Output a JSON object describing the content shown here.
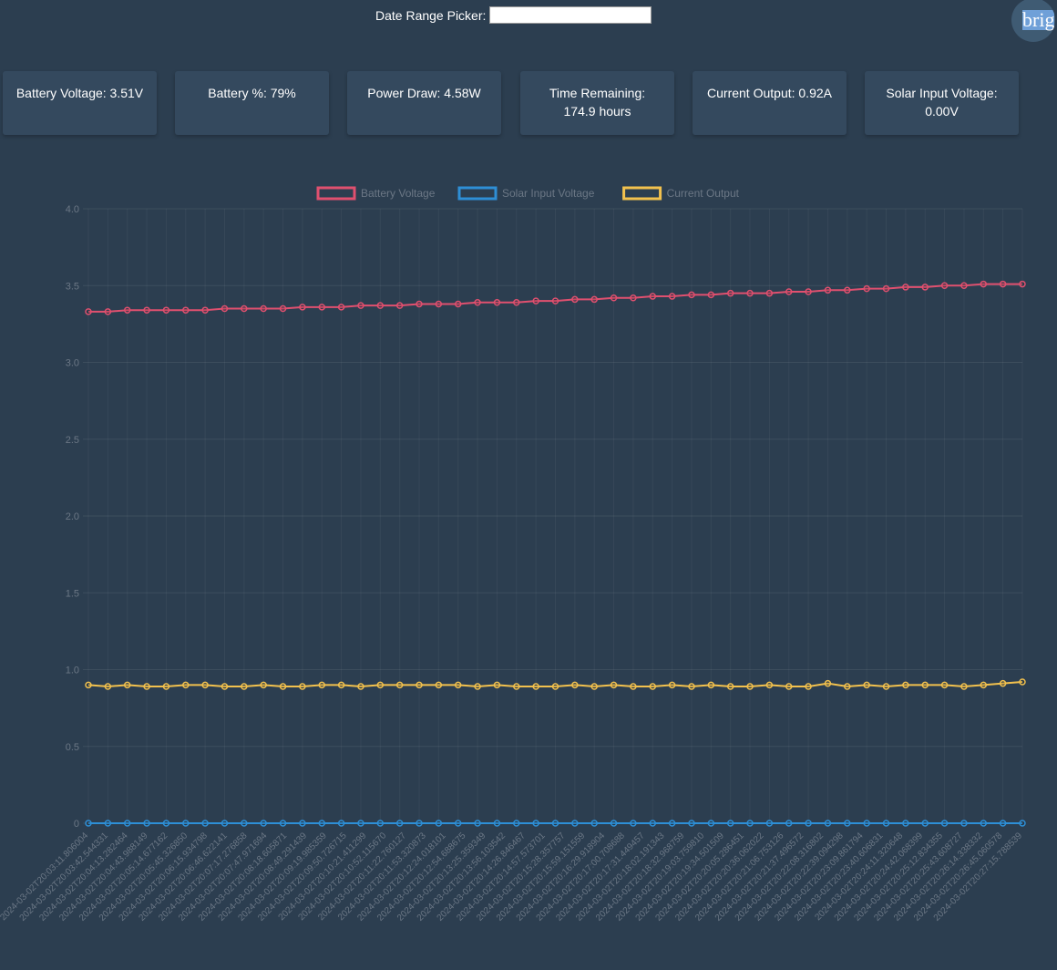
{
  "header": {
    "date_label": "Date Range Picker:",
    "date_value": "",
    "avatar_text": "brig"
  },
  "cards": [
    {
      "label": "Battery Voltage: 3.51V"
    },
    {
      "label": "Battery %: 79%"
    },
    {
      "label": "Power Draw: 4.58W"
    },
    {
      "label": "Time Remaining: 174.9 hours"
    },
    {
      "label": "Current Output: 0.92A"
    },
    {
      "label": "Solar Input Voltage: 0.00V"
    }
  ],
  "colors": {
    "background": "#2c3e50",
    "card": "#34495e",
    "battery": "#e0506f",
    "solar": "#2e8fd6",
    "current": "#f2c14e"
  },
  "chart_data": {
    "type": "line",
    "ylim": [
      0,
      4
    ],
    "yticks": [
      "0",
      "0.5",
      "1.0",
      "1.5",
      "2.0",
      "2.5",
      "3.0",
      "3.5",
      "4.0"
    ],
    "grid": true,
    "legend_position": "top-center",
    "x_tick_labels": [
      "2024-03-02T20:03:11.806004",
      "2024-03-02T20:03:42.544331",
      "2024-03-02T20:04:13.282464",
      "2024-03-02T20:04:43.988149",
      "2024-03-02T20:05:14.677162",
      "2024-03-02T20:05:45.326850",
      "2024-03-02T20:06:15.934798",
      "2024-03-02T20:06:46.622141",
      "2024-03-02T20:07:17.276858",
      "2024-03-02T20:07:47.971694",
      "2024-03-02T20:08:18.605871",
      "2024-03-02T20:08:49.291439",
      "2024-03-02T20:09:19.985359",
      "2024-03-02T20:09:50.726715",
      "2024-03-02T20:10:21.411299",
      "2024-03-02T20:10:52.115670",
      "2024-03-02T20:11:22.760127",
      "2024-03-02T20:11:53.320873",
      "2024-03-02T20:12:24.018101",
      "2024-03-02T20:12:54.688675",
      "2024-03-02T20:13:25.359349",
      "2024-03-02T20:13:56.103542",
      "2024-03-02T20:14:26.846467",
      "2024-03-02T20:14:57.573701",
      "2024-03-02T20:15:28.357757",
      "2024-03-02T20:15:59.151559",
      "2024-03-02T20:16:29.918904",
      "2024-03-02T20:17:00.708688",
      "2024-03-02T20:17:31.449457",
      "2024-03-02T20:18:02.191343",
      "2024-03-02T20:18:32.968759",
      "2024-03-02T20:19:03.759810",
      "2024-03-02T20:19:34.501509",
      "2024-03-02T20:20:05.286451",
      "2024-03-02T20:20:36.062022",
      "2024-03-02T20:21:06.753126",
      "2024-03-02T20:21:37.496572",
      "2024-03-02T20:22:08.316802",
      "2024-03-02T20:22:39.094298",
      "2024-03-02T20:23:09.861794",
      "2024-03-02T20:23:40.606831",
      "2024-03-02T20:24:11.320648",
      "2024-03-02T20:24:42.068399",
      "2024-03-02T20:25:12.834355",
      "2024-03-02T20:25:43.608727",
      "2024-03-02T20:26:14.338332",
      "2024-03-02T20:26:45.060578",
      "2024-03-02T20:27:15.788539"
    ],
    "series": [
      {
        "name": "Battery Voltage",
        "color": "#e0506f",
        "values": [
          3.33,
          3.33,
          3.34,
          3.34,
          3.34,
          3.34,
          3.34,
          3.35,
          3.35,
          3.35,
          3.35,
          3.36,
          3.36,
          3.36,
          3.37,
          3.37,
          3.37,
          3.38,
          3.38,
          3.38,
          3.39,
          3.39,
          3.39,
          3.4,
          3.4,
          3.41,
          3.41,
          3.42,
          3.42,
          3.43,
          3.43,
          3.44,
          3.44,
          3.45,
          3.45,
          3.45,
          3.46,
          3.46,
          3.47,
          3.47,
          3.48,
          3.48,
          3.49,
          3.49,
          3.5,
          3.5,
          3.51,
          3.51,
          3.51
        ]
      },
      {
        "name": "Solar Input Voltage",
        "color": "#2e8fd6",
        "values": [
          0,
          0,
          0,
          0,
          0,
          0,
          0,
          0,
          0,
          0,
          0,
          0,
          0,
          0,
          0,
          0,
          0,
          0,
          0,
          0,
          0,
          0,
          0,
          0,
          0,
          0,
          0,
          0,
          0,
          0,
          0,
          0,
          0,
          0,
          0,
          0,
          0,
          0,
          0,
          0,
          0,
          0,
          0,
          0,
          0,
          0,
          0,
          0,
          0
        ]
      },
      {
        "name": "Current Output",
        "color": "#f2c14e",
        "values": [
          0.9,
          0.89,
          0.9,
          0.89,
          0.89,
          0.9,
          0.9,
          0.89,
          0.89,
          0.9,
          0.89,
          0.89,
          0.9,
          0.9,
          0.89,
          0.9,
          0.9,
          0.9,
          0.9,
          0.9,
          0.89,
          0.9,
          0.89,
          0.89,
          0.89,
          0.9,
          0.89,
          0.9,
          0.89,
          0.89,
          0.9,
          0.89,
          0.9,
          0.89,
          0.89,
          0.9,
          0.89,
          0.89,
          0.91,
          0.89,
          0.9,
          0.89,
          0.9,
          0.9,
          0.9,
          0.89,
          0.9,
          0.91,
          0.92
        ]
      }
    ]
  }
}
